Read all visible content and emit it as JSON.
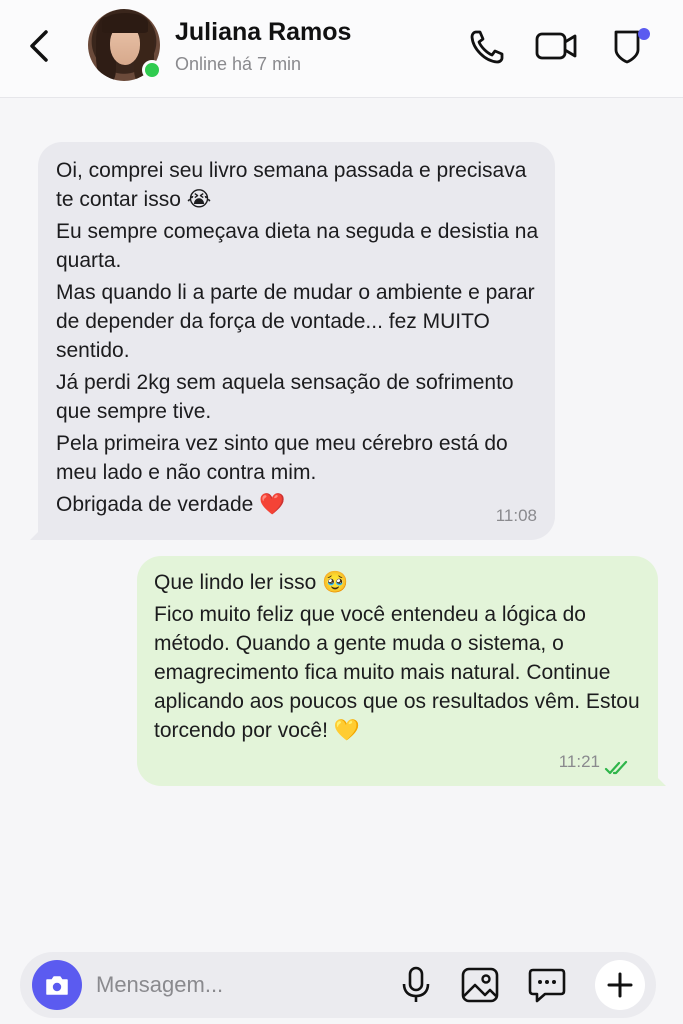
{
  "header": {
    "contact_name": "Juliana Ramos",
    "status": "Online há 7 min",
    "icons": [
      "back-icon",
      "phone-icon",
      "video-icon",
      "shield-notification-icon"
    ]
  },
  "messages": [
    {
      "direction": "incoming",
      "lines": [
        "Oi, comprei seu livro semana passada e precisava te contar isso 😭",
        "Eu sempre começava dieta na seguda e desistia na quarta.",
        "Mas quando li a parte de mudar o ambiente e parar de depender da força de vontade... fez MUITO sentido.",
        "Já perdi 2kg sem aquela sensação de sofrimento que sempre tive.",
        "Pela primeira vez sinto que meu cérebro está do meu lado e não contra mim.",
        "Obrigada de verdade ❤️"
      ],
      "time": "11:08"
    },
    {
      "direction": "outgoing",
      "lines": [
        "Que lindo ler isso 🥹",
        "Fico muito feliz que você entendeu a lógica do método. Quando a gente muda o sistema, o emagrecimento fica muito mais natural. Continue aplicando aos poucos que os resultados vêm. Estou torcendo por você! 💛"
      ],
      "time": "11:21",
      "status": "read"
    }
  ],
  "input": {
    "placeholder": "Mensagem..."
  },
  "colors": {
    "accent": "#5b5bf0",
    "online": "#2fcb4f",
    "incoming_bubble": "#e9e9ee",
    "outgoing_bubble": "#e3f4d9",
    "read_ticks": "#2fb54a"
  }
}
